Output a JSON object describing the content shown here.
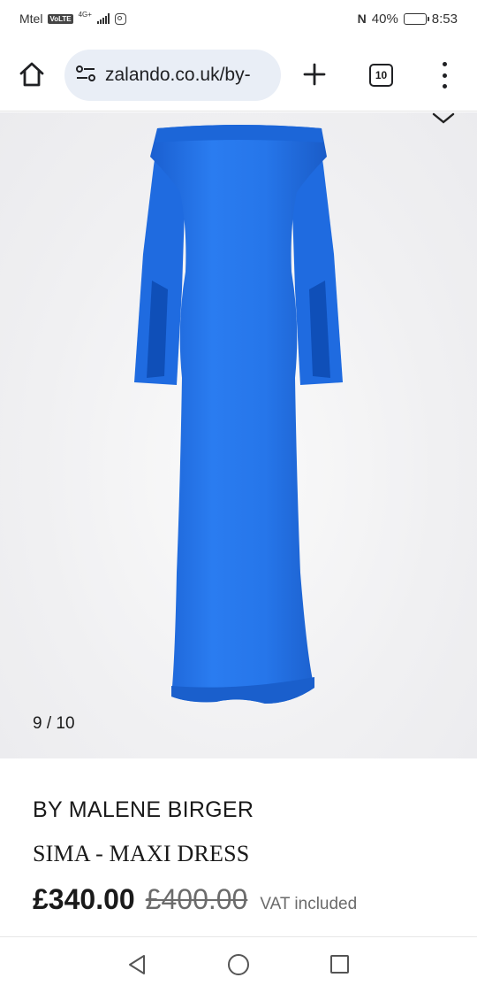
{
  "status_bar": {
    "carrier": "Mtel",
    "volte": "VoLTE",
    "network": "4G+",
    "battery_percent": "40%",
    "battery_level": 0.4,
    "time": "8:53"
  },
  "browser": {
    "url": "zalando.co.uk/by-",
    "tab_count": "10"
  },
  "gallery": {
    "counter": "9 / 10",
    "dress_color": "#1f6fe0"
  },
  "product": {
    "brand": "BY MALENE BIRGER",
    "name": "SIMA - MAXI DRESS",
    "price": "£340.00",
    "original_price": "£400.00",
    "vat_note": "VAT included"
  },
  "icons": [
    "home-icon",
    "site-info-icon",
    "new-tab-icon",
    "tab-switcher-icon",
    "overflow-menu-icon",
    "chevron-down-icon",
    "back-icon",
    "home-circle-icon",
    "recents-icon"
  ]
}
